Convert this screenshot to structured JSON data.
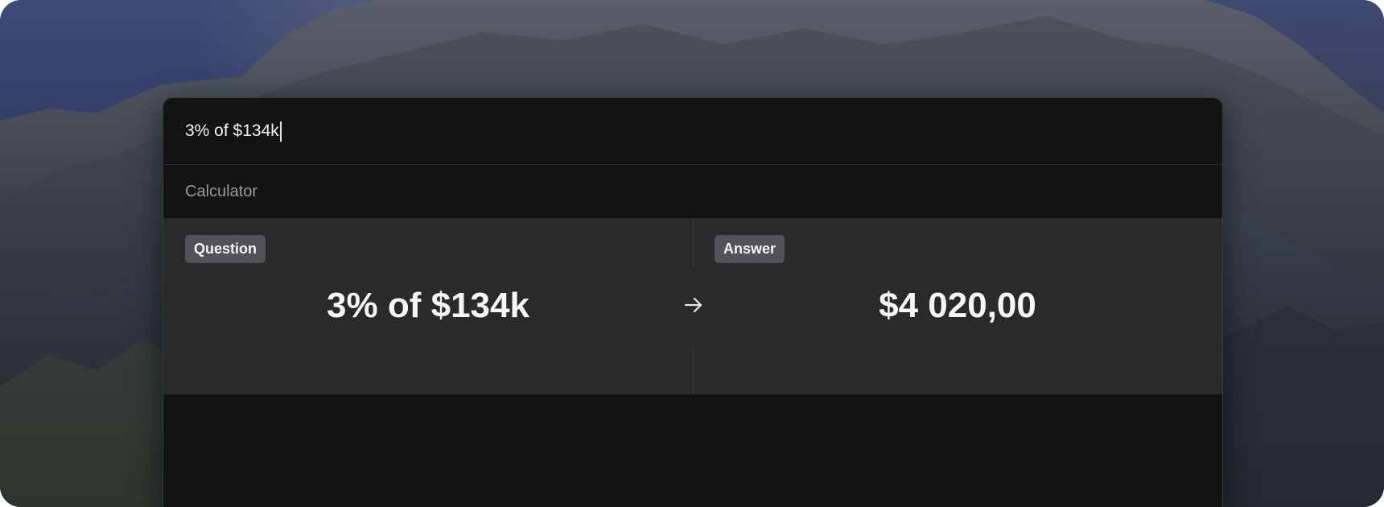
{
  "search": {
    "query": "3% of $134k"
  },
  "section": {
    "title": "Calculator"
  },
  "calculator": {
    "question_label": "Question",
    "question_value": "3% of $134k",
    "answer_label": "Answer",
    "answer_value": "$4 020,00",
    "arrow_icon": "arrow-right-icon"
  },
  "colors": {
    "panel_bg": "#131315",
    "result_bg": "#2a2a2d",
    "badge_bg": "#535357",
    "text_primary": "#f6f6f8",
    "text_secondary": "#9a9a9e"
  }
}
